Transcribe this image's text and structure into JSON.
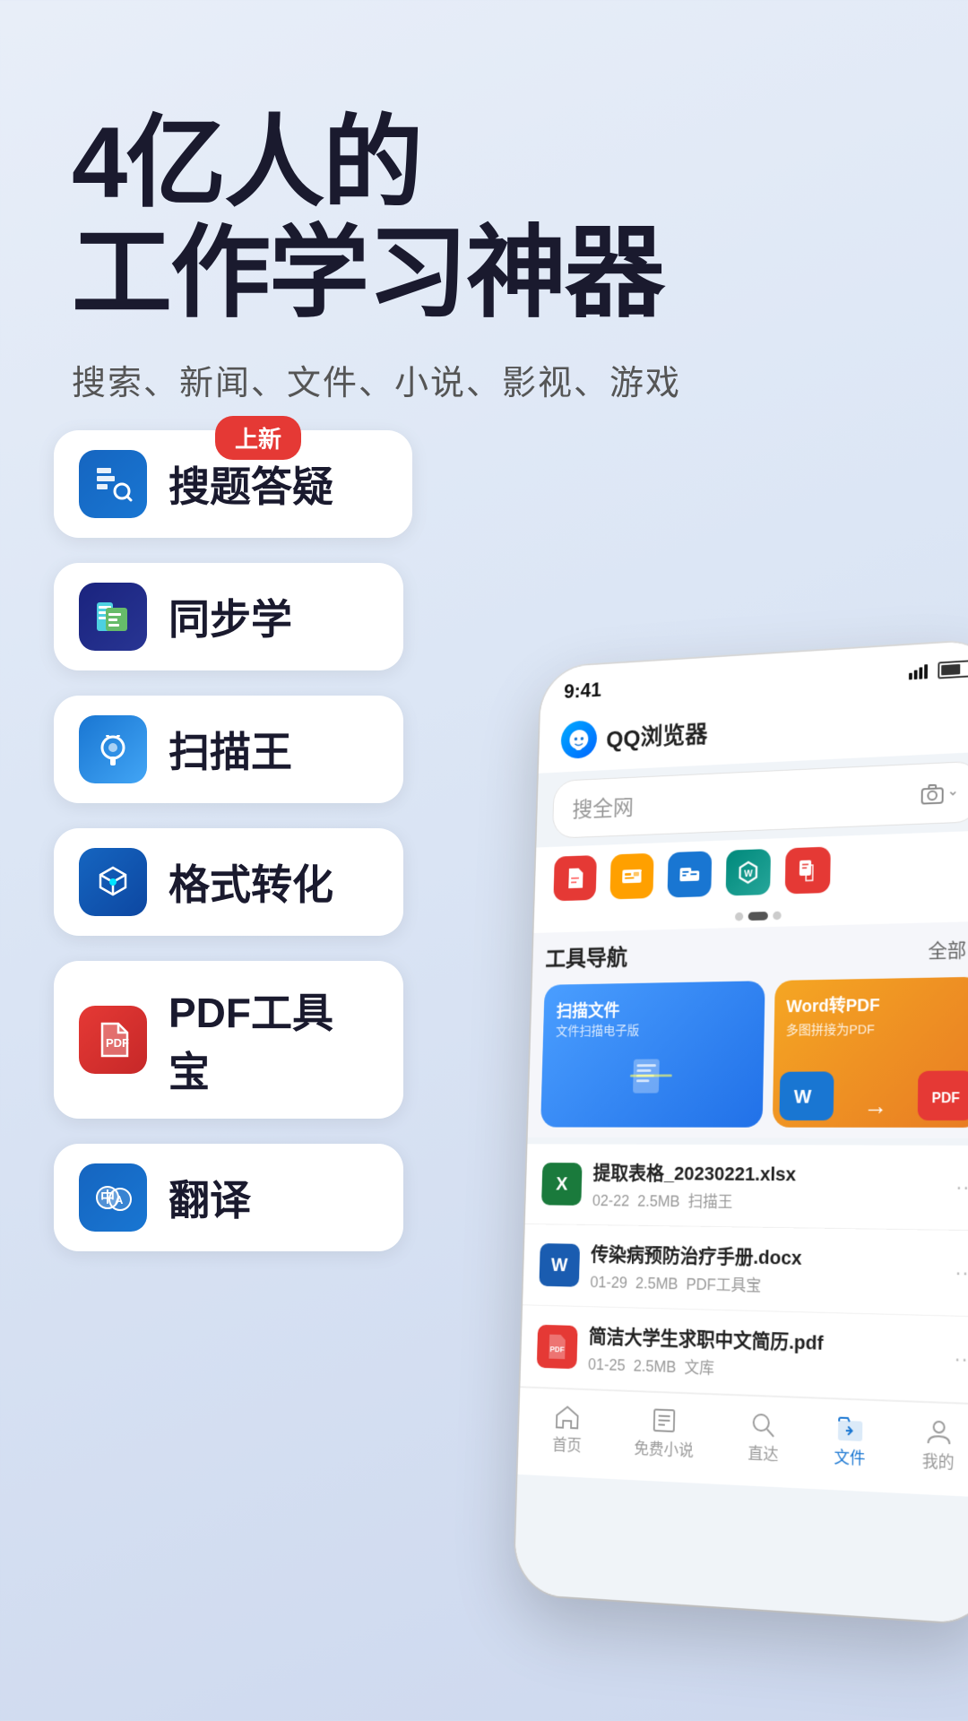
{
  "hero": {
    "title_line1": "4亿人的",
    "title_line2": "工作学习神器",
    "subtitle": "搜索、新闻、文件、小说、影视、游戏"
  },
  "features": [
    {
      "id": "search-qa",
      "label": "搜题答疑",
      "icon_class": "icon-search-q",
      "icon_text": "🔍",
      "badge": "上新"
    },
    {
      "id": "sync-learn",
      "label": "同步学",
      "icon_class": "icon-sync",
      "icon_text": "📚",
      "badge": null
    },
    {
      "id": "scan-king",
      "label": "扫描王",
      "icon_class": "icon-scan",
      "icon_text": "📷",
      "badge": null
    },
    {
      "id": "format-convert",
      "label": "格式转化",
      "icon_class": "icon-format",
      "icon_text": "⚡",
      "badge": null
    },
    {
      "id": "pdf-tool",
      "label": "PDF工具宝",
      "icon_class": "icon-pdf",
      "icon_text": "📄",
      "badge": null
    },
    {
      "id": "translate",
      "label": "翻译",
      "icon_class": "icon-translate",
      "icon_text": "🌐",
      "badge": null
    }
  ],
  "phone": {
    "status_time": "9:41",
    "browser_name": "QQ浏览器",
    "search_placeholder": "搜全网",
    "tools_title": "工具导航",
    "tools_all": "全部",
    "tool_cards": [
      {
        "label": "扫描文件",
        "sub": "文件扫描电子版"
      },
      {
        "label": "Word转PDF",
        "sub": "多图拼接为PDF"
      }
    ],
    "files": [
      {
        "name": "提取表格_20230221.xlsx",
        "date": "02-22",
        "size": "2.5MB",
        "source": "扫描王",
        "type": "xlsx"
      },
      {
        "name": "传染病预防治疗手册.docx",
        "date": "01-29",
        "size": "2.5MB",
        "source": "PDF工具宝",
        "type": "docx"
      },
      {
        "name": "简洁大学生求职中文简历.pdf",
        "date": "01-25",
        "size": "2.5MB",
        "source": "文库",
        "type": "pdf"
      }
    ],
    "nav_items": [
      {
        "label": "首页",
        "icon": "⌂",
        "active": false
      },
      {
        "label": "免费小说",
        "icon": "📖",
        "active": false
      },
      {
        "label": "直达",
        "icon": "🔍",
        "active": false
      },
      {
        "label": "文件",
        "icon": "📁",
        "active": true
      },
      {
        "label": "我的",
        "icon": "👤",
        "active": false
      }
    ]
  }
}
